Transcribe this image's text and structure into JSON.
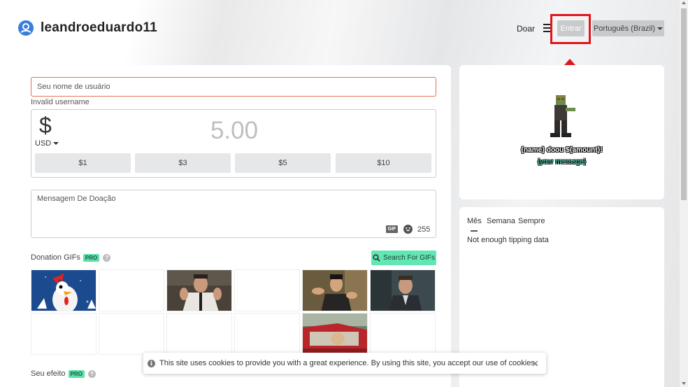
{
  "header": {
    "username": "leandroeduardo11",
    "nav_doar": "Doar",
    "entrar_label": "Entrar",
    "language_label": "Português (Brazil)"
  },
  "form": {
    "username_placeholder": "Seu nome de usuário",
    "invalid_text": "Invalid username",
    "currency_symbol": "$",
    "currency_code": "USD",
    "amount": "5.00",
    "presets": [
      "$1",
      "$3",
      "$5",
      "$10"
    ],
    "message_placeholder": "Mensagem De Doação",
    "gif_badge": "GIF",
    "char_count": "255"
  },
  "sections": {
    "donation_gifs": "Donation GIFs",
    "pro": "PRO",
    "search_gifs": "Search For GIFs",
    "seu_efeito": "Seu efeito"
  },
  "alert_preview": {
    "text": "{name} doou ${amount}!",
    "message": "{your message}"
  },
  "top_donors": {
    "tabs": [
      "Mês",
      "Semana",
      "Sempre"
    ],
    "empty_text": "Not enough tipping data"
  },
  "cookie": {
    "text": "This site uses cookies to provide you with a great experience. By using this site, you accept our use of cookies."
  },
  "colors": {
    "accent_blue": "#3b7ddd",
    "highlight_red": "#e0161b",
    "pro_green": "#5be0a8"
  }
}
